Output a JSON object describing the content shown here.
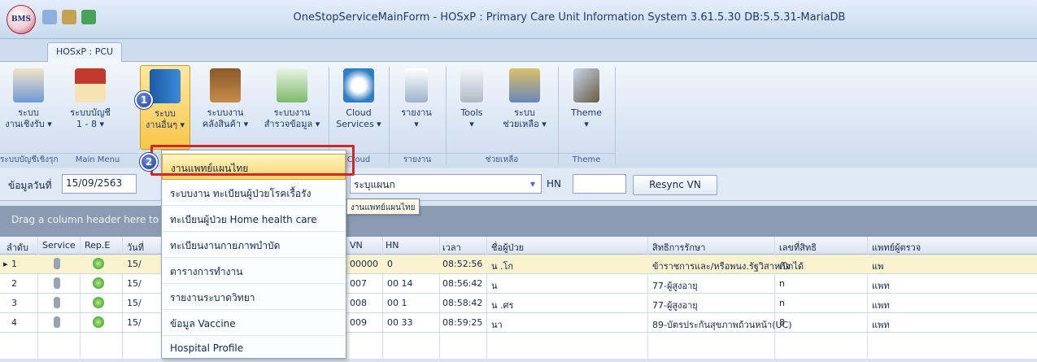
{
  "window": {
    "logo_text": "BMS",
    "title": "OneStopServiceMainForm - HOSxP : Primary Care Unit Information System 3.61.5.30 DB:5.5.31-MariaDB"
  },
  "ribbon_tab": "HOSxP : PCU",
  "ribbon": {
    "buttons": [
      {
        "l1": "ระบบ",
        "l2": "งานเชิงรับ ▾",
        "icon": "doctor-icon"
      },
      {
        "l1": "ระบบบัญชี",
        "l2": "1 - 8 ▾",
        "icon": "house-icon"
      },
      {
        "l1": "ระบบ",
        "l2": "งานอื่นๆ ▾",
        "icon": "book-icon"
      },
      {
        "l1": "ระบบงาน",
        "l2": "คลังสินค้า ▾",
        "icon": "warehouse-icon"
      },
      {
        "l1": "ระบบงาน",
        "l2": "สำรวจข้อมูล ▾",
        "icon": "spreadsheet-icon"
      },
      {
        "l1": "Cloud",
        "l2": "Services ▾",
        "icon": "cloud-icon"
      },
      {
        "l1": "รายงาน",
        "l2": "▾",
        "icon": "report-icon"
      },
      {
        "l1": "Tools",
        "l2": "▾",
        "icon": "tools-icon"
      },
      {
        "l1": "ระบบ",
        "l2": "ช่วยเหลือ ▾",
        "icon": "help-book-icon"
      },
      {
        "l1": "Theme",
        "l2": "▾",
        "icon": "paintbrush-icon"
      }
    ],
    "groups": [
      "ระบบบัญชีเชิงรุก",
      "Main Menu",
      "Cloud",
      "รายงาน",
      "ช่วยเหลือ",
      "Theme"
    ]
  },
  "toolbar": {
    "date_label": "ข้อมูลวันที่",
    "date_value": "15/09/2563",
    "dept_value": "ระบุแผนก",
    "hn_label": "HN",
    "hn_value": "",
    "resync_label": "Resync VN"
  },
  "grid": {
    "group_hint": "Drag a column header here to group by that column",
    "columns": [
      "ลำดับ",
      "Service",
      "Rep.E",
      "วันที่",
      "VN",
      "HN",
      "เวลา",
      "ชื่อผู้ป่วย",
      "สิทธิการรักษา",
      "เลขที่สิทธิ",
      "แพทย์ผู้ตรวจ"
    ],
    "rows": [
      {
        "no": "1",
        "date": "15/",
        "vn": "00000",
        "hn": "0",
        "time": "08:52:56",
        "name": "น                  .โก",
        "right": "ข้าราชการและ/หรือพนง.รัฐวิสาหกิจ",
        "right_no": "เบิกได้",
        "doctor": "แพ"
      },
      {
        "no": "2",
        "date": "15/",
        "vn": "007",
        "hn": "00   14",
        "time": "08:56:42",
        "name": "น",
        "right": "77-ผู้สูงอายุ",
        "right_no": "n",
        "doctor": "แพท"
      },
      {
        "no": "3",
        "date": "15/",
        "vn": "008",
        "hn": "00   1",
        "time": "08:58:42",
        "name": "น                  .ศร",
        "right": "77-ผู้สูงอายุ",
        "right_no": "n",
        "doctor": "แพท"
      },
      {
        "no": "4",
        "date": "15/",
        "vn": "009",
        "hn": "00   33",
        "time": "08:59:25",
        "name": "นา",
        "right": "89-บัตรประกันสุขภาพถ้วนหน้า(UC)",
        "right_no": "8",
        "doctor": "แพท"
      }
    ]
  },
  "dropdown": {
    "items": [
      "งานแพทย์แผนไทย",
      "ระบบงาน ทะเบียนผู้ป่วยโรคเรื้อรัง",
      "ทะเบียนผู้ป่วย Home health care",
      "ทะเบียนงานกายภาพบำบัด",
      "ตารางการทำงาน",
      "รายงานระบาดวิทยา",
      "ข้อมูล Vaccine",
      "Hospital Profile"
    ],
    "tooltip": "งานแพทย์แผนไทย"
  },
  "annotations": {
    "step1": "1",
    "step2": "2",
    "box_color": "#d22626"
  }
}
